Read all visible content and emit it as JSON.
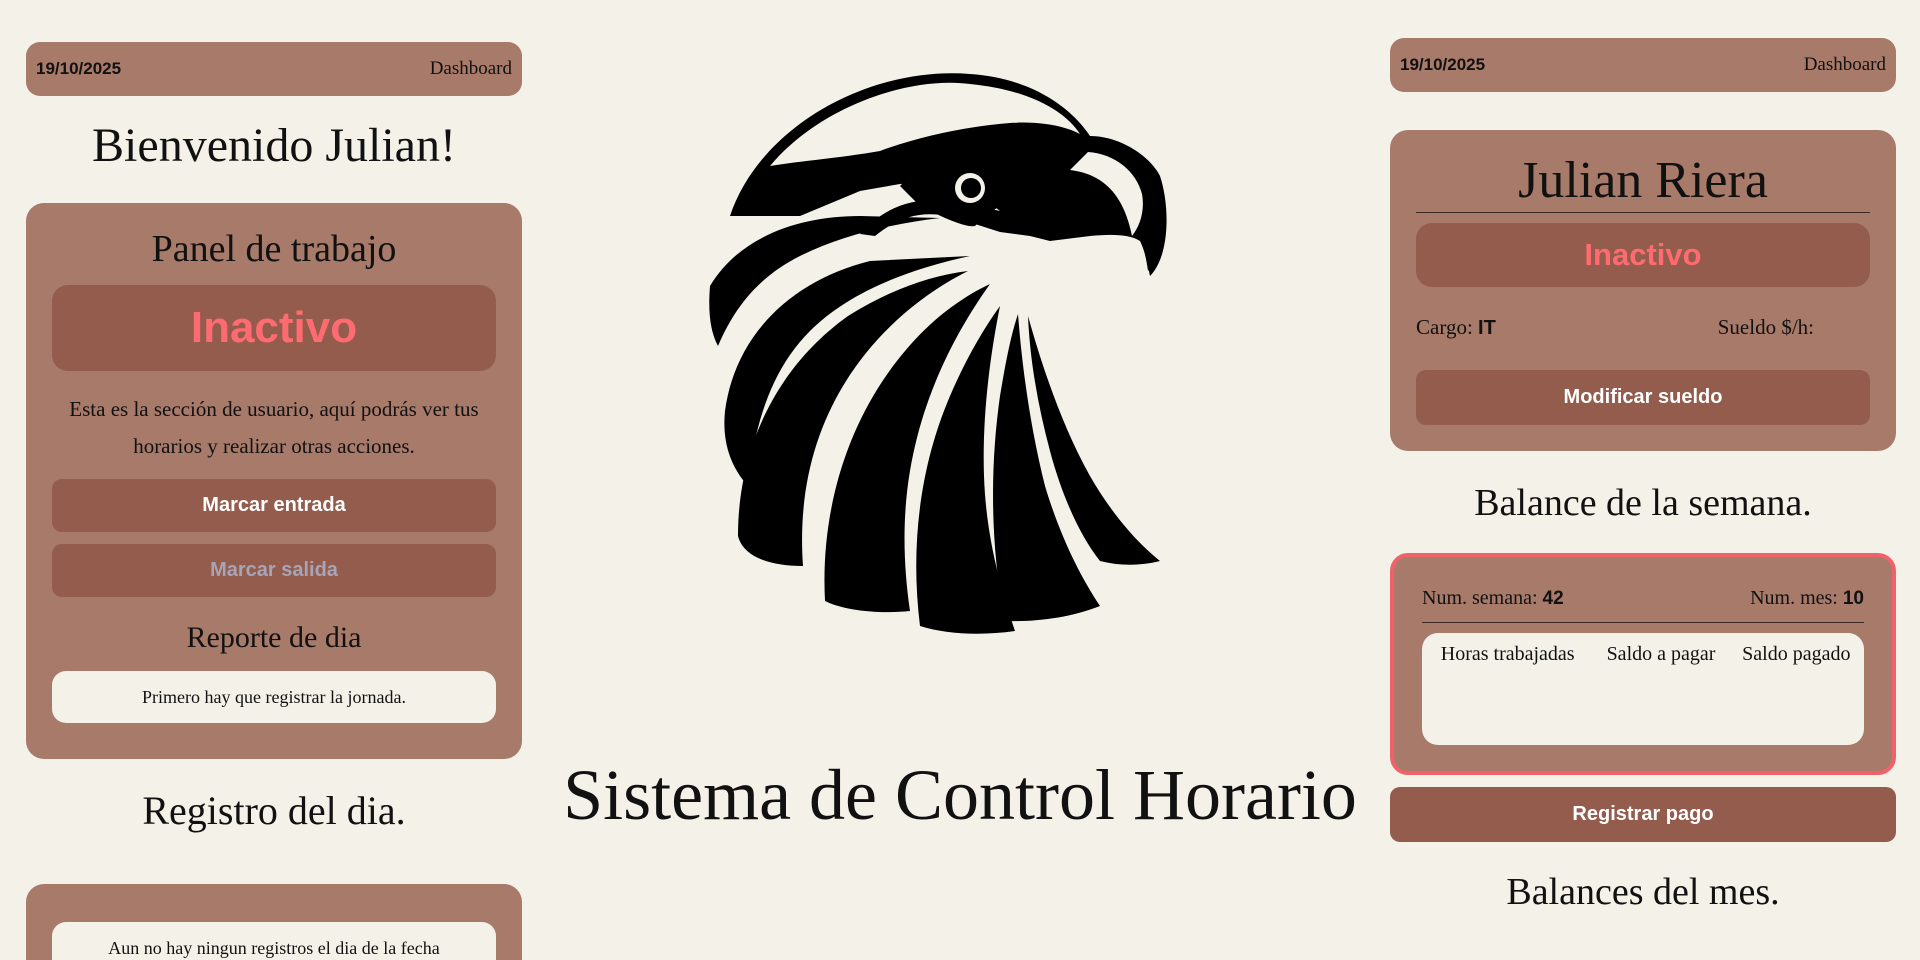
{
  "left": {
    "topbar": {
      "date": "19/10/2025",
      "dashboard": "Dashboard"
    },
    "welcome": "Bienvenido Julian!",
    "panel": {
      "title": "Panel de trabajo",
      "status": "Inactivo",
      "description": "Esta es la sección de usuario, aquí podrás ver tus horarios y realizar otras acciones.",
      "clock_in": "Marcar entrada",
      "clock_out": "Marcar salida",
      "report_title": "Reporte de dia",
      "report_note": "Primero hay que registrar la jornada."
    },
    "registro_title": "Registro del dia.",
    "registro_note": "Aun no hay ningun registros el dia de la fecha"
  },
  "center": {
    "logo_icon": "eagle-head-icon",
    "title": "Sistema de Control Horario"
  },
  "right": {
    "topbar": {
      "date": "19/10/2025",
      "dashboard": "Dashboard"
    },
    "profile": {
      "name": "Julian Riera",
      "status": "Inactivo",
      "cargo_label": "Cargo:",
      "cargo_value": "IT",
      "sueldo_label": "Sueldo $/h:",
      "modify_button": "Modificar sueldo"
    },
    "balance_title": "Balance de la semana.",
    "balance": {
      "week_label": "Num. semana:",
      "week_value": "42",
      "month_label": "Num. mes:",
      "month_value": "10",
      "columns": [
        "Horas trabajadas",
        "Saldo a pagar",
        "Saldo pagado"
      ]
    },
    "pay_button": "Registrar pago",
    "balances_month_title": "Balances del mes."
  },
  "colors": {
    "background": "#f3f1e8",
    "card": "#a77a6a",
    "button": "#935c4c",
    "status_inactive": "#ff6b70",
    "highlight_border": "#f0626a"
  }
}
